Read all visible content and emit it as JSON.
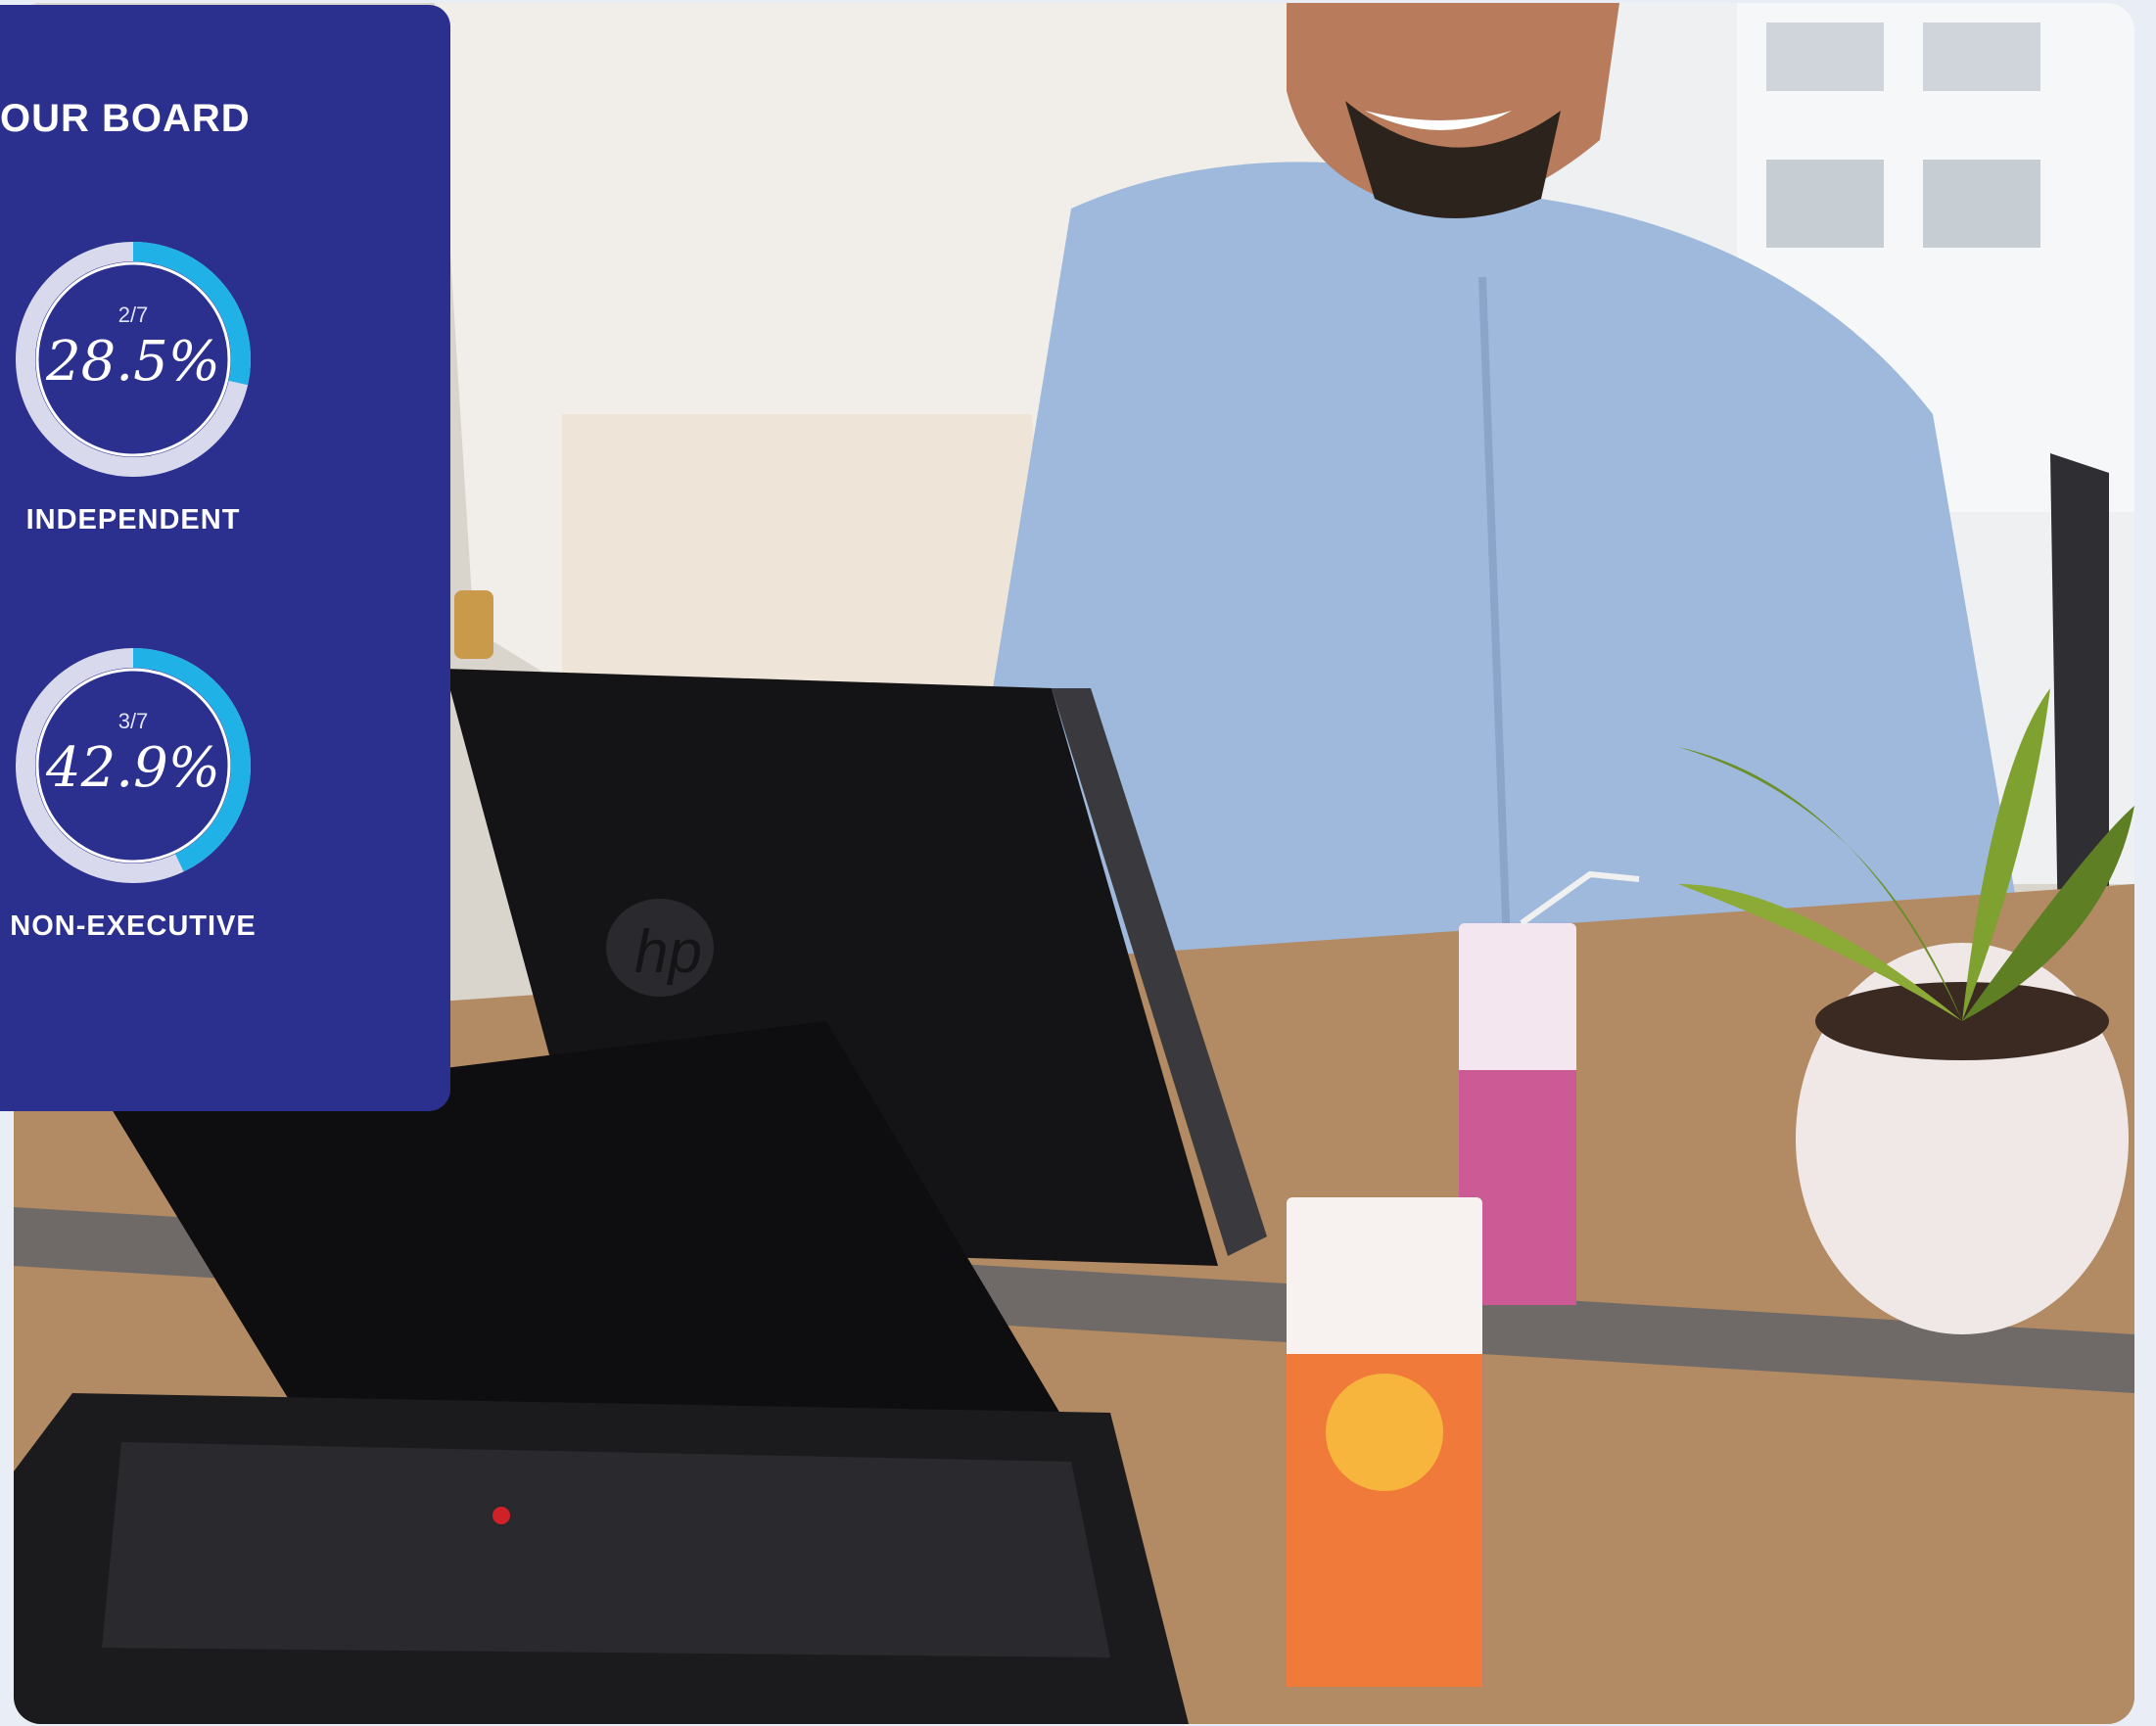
{
  "board": {
    "title": "OUR BOARD",
    "metrics": [
      {
        "fraction": "2/7",
        "percent": "28.5%",
        "label": "INDEPENDENT",
        "value": 0.285
      },
      {
        "fraction": "3/7",
        "percent": "42.9%",
        "label": "NON-EXECUTIVE",
        "value": 0.429
      }
    ]
  },
  "colors": {
    "panel": "#2b2f8d",
    "ring_track": "#d8d9ec",
    "ring_fill": "#20b2e6",
    "text": "#ffffff"
  },
  "photo": {
    "brand_mark": "hp"
  }
}
